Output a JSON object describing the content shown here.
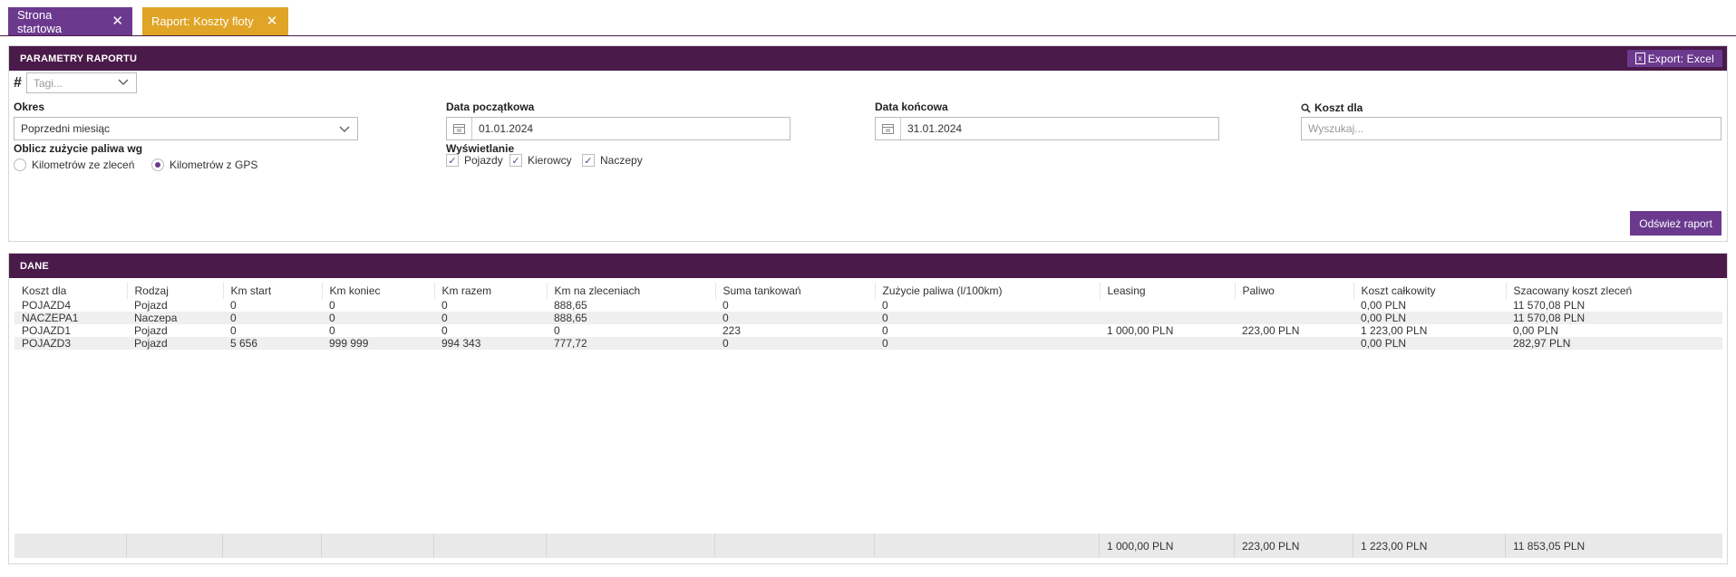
{
  "tabs": [
    {
      "label": "Strona startowa"
    },
    {
      "label": "Raport: Koszty floty"
    }
  ],
  "params": {
    "title": "PARAMETRY RAPORTU",
    "export_label": "Export: Excel",
    "tags_placeholder": "Tagi...",
    "hash": "#",
    "okres_label": "Okres",
    "okres_value": "Poprzedni miesiąc",
    "start_label": "Data początkowa",
    "start_value": "01.01.2024",
    "end_label": "Data końcowa",
    "end_value": "31.01.2024",
    "koszt_label": "Koszt dla",
    "koszt_placeholder": "Wyszukaj...",
    "fuel_label": "Oblicz zużycie paliwa wg",
    "radio_orders": "Kilometrów ze zleceń",
    "radio_gps": "Kilometrów z GPS",
    "display_label": "Wyświetlanie",
    "check_vehicles": "Pojazdy",
    "check_drivers": "Kierowcy",
    "check_trailers": "Naczepy",
    "refresh_label": "Odśwież raport"
  },
  "data_panel": {
    "title": "DANE",
    "columns": [
      "Koszt dla",
      "Rodzaj",
      "Km start",
      "Km koniec",
      "Km razem",
      "Km na zleceniach",
      "Suma tankowań",
      "Zużycie paliwa (l/100km)",
      "Leasing",
      "Paliwo",
      "Koszt całkowity",
      "Szacowany koszt zleceń"
    ],
    "rows": [
      [
        "POJAZD4",
        "Pojazd",
        "0",
        "0",
        "0",
        "888,65",
        "0",
        "0",
        "",
        "",
        "0,00 PLN",
        "11 570,08 PLN"
      ],
      [
        "NACZEPA1",
        "Naczepa",
        "0",
        "0",
        "0",
        "888,65",
        "0",
        "0",
        "",
        "",
        "0,00 PLN",
        "11 570,08 PLN"
      ],
      [
        "POJAZD1",
        "Pojazd",
        "0",
        "0",
        "0",
        "0",
        "223",
        "0",
        "1 000,00 PLN",
        "223,00 PLN",
        "1 223,00 PLN",
        "0,00 PLN"
      ],
      [
        "POJAZD3",
        "Pojazd",
        "5 656",
        "999 999",
        "994 343",
        "777,72",
        "0",
        "0",
        "",
        "",
        "0,00 PLN",
        "282,97 PLN"
      ]
    ],
    "totals": [
      "",
      "",
      "",
      "",
      "",
      "",
      "",
      "",
      "1 000,00 PLN",
      "223,00 PLN",
      "1 223,00 PLN",
      "11 853,05 PLN"
    ]
  },
  "colors": {
    "purple": "#6b3a8e",
    "dark_header": "#4a1a4a",
    "accent_tab": "#e0a526"
  }
}
